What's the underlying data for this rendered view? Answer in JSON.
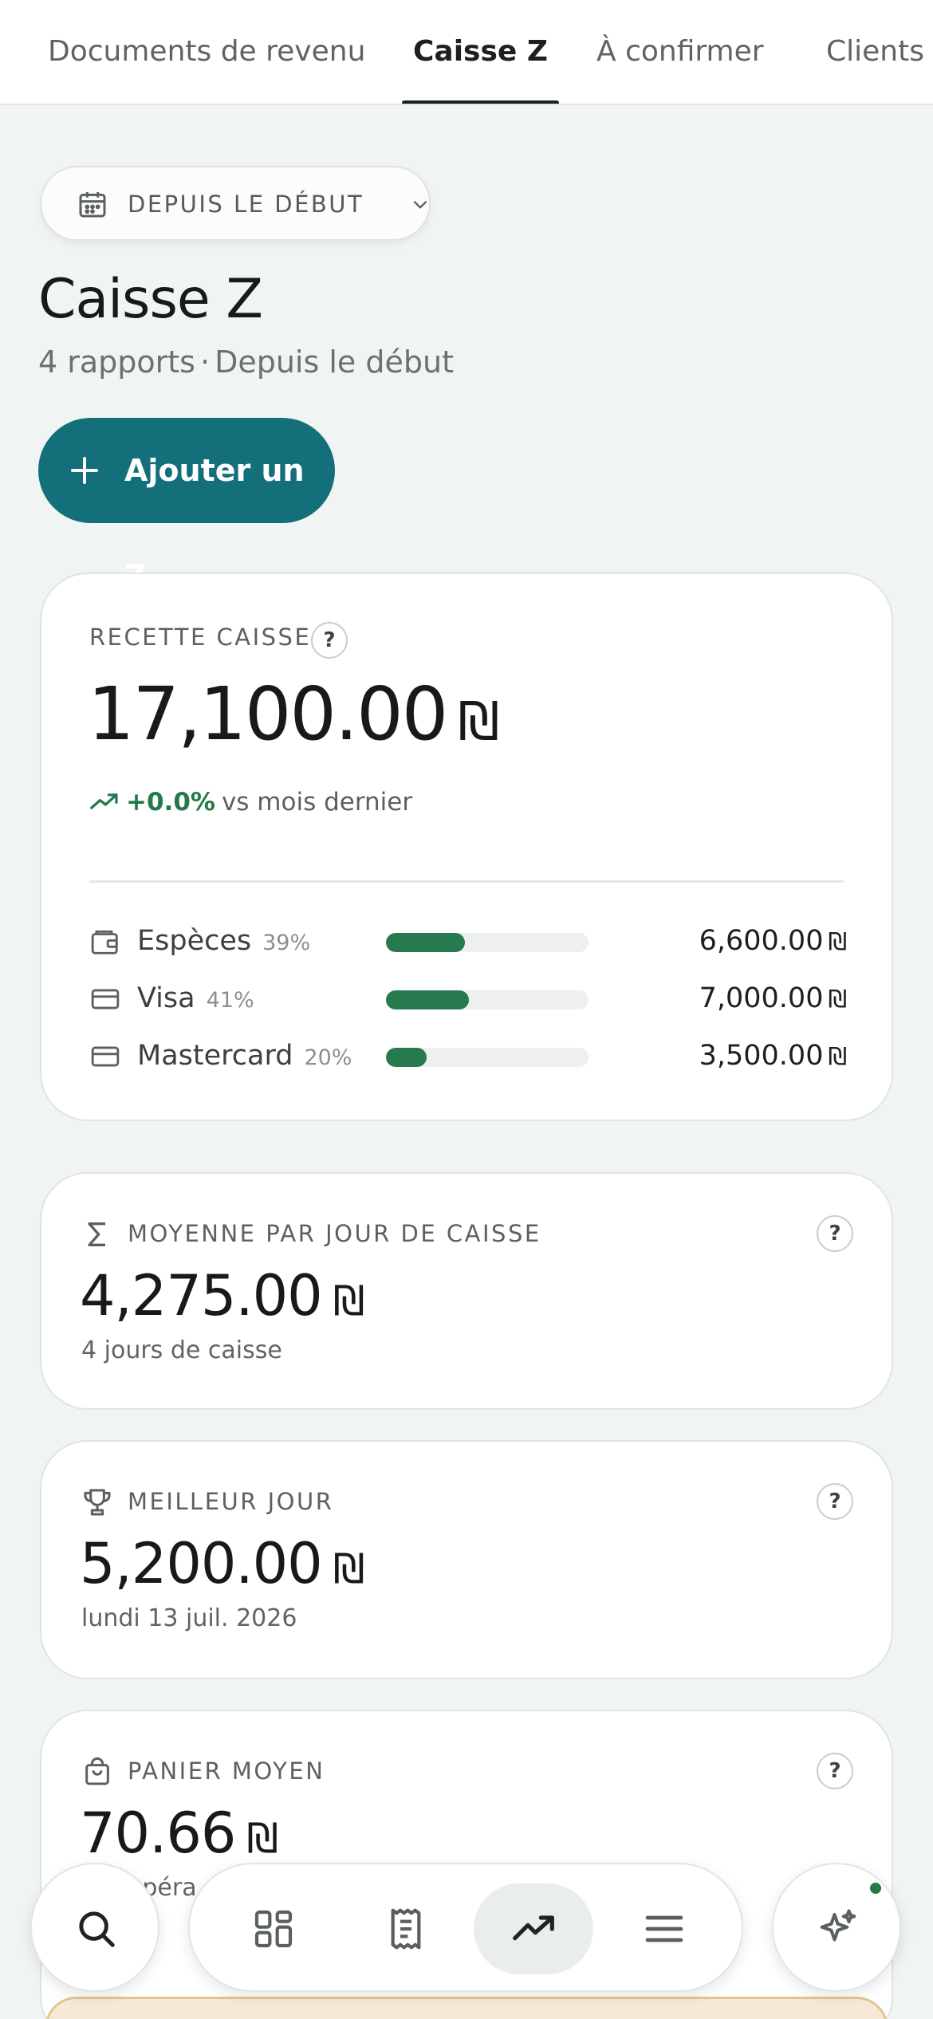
{
  "tabs": [
    {
      "label": "Documents de revenu",
      "active": false
    },
    {
      "label": "Caisse Z",
      "active": true
    },
    {
      "label": "À confirmer",
      "active": false
    },
    {
      "label": "Clients",
      "active": false
    }
  ],
  "filter": {
    "label": "DEPUIS LE DÉBUT",
    "icon": "calendar-icon"
  },
  "header": {
    "title": "Caisse Z",
    "reports": "4 rapports",
    "separator": "·",
    "period": "Depuis le début"
  },
  "add_button": {
    "label": "Ajouter un Z"
  },
  "currency": "₪",
  "revenue": {
    "label": "RECETTE CAISSE",
    "help": "?",
    "amount": "17,100.00",
    "trend_pct": "+0.0%",
    "trend_text": "vs mois dernier",
    "methods": [
      {
        "name": "Espèces",
        "pct": "39%",
        "share": 0.39,
        "amount": "6,600.00",
        "icon": "wallet-icon"
      },
      {
        "name": "Visa",
        "pct": "41%",
        "share": 0.41,
        "amount": "7,000.00",
        "icon": "credit-card-icon"
      },
      {
        "name": "Mastercard",
        "pct": "20%",
        "share": 0.2,
        "amount": "3,500.00",
        "icon": "credit-card-icon"
      }
    ]
  },
  "average": {
    "label": "MOYENNE PAR JOUR DE CAISSE",
    "help": "?",
    "amount": "4,275.00",
    "caption": "4 jours de caisse"
  },
  "best_day": {
    "label": "MEILLEUR JOUR",
    "help": "?",
    "amount": "5,200.00",
    "caption": "lundi 13 juil. 2026"
  },
  "basket": {
    "label": "PANIER MOYEN",
    "help": "?",
    "amount": "70.66",
    "caption_partial": "opéra"
  },
  "colors": {
    "accent": "#13707a",
    "positive": "#23794a",
    "bar_fill": "#267a4e",
    "background": "#f0f4f2"
  },
  "bottom_nav": {
    "search_icon": "search-icon",
    "items": [
      "dashboard-icon",
      "receipt-icon",
      "trending-up-icon",
      "menu-icon"
    ],
    "active": "trending-up-icon",
    "assistant_icon": "sparkles-icon"
  }
}
